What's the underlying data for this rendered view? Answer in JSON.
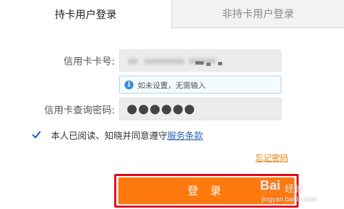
{
  "tabs": {
    "active_label": "持卡用户登录",
    "inactive_label": "非持卡用户登录"
  },
  "form": {
    "card_label": "信用卡卡号:",
    "card_value_masked": "",
    "hint_icon": "info-icon",
    "hint_text": "如未设置，无需输入",
    "password_label": "信用卡查询密码:",
    "password_mask": "●●●●●●"
  },
  "agreement": {
    "checked": true,
    "text": "本人已阅读、知晓并同意遵守",
    "link": "服务条款"
  },
  "forgot_password": "忘记密码",
  "login_button": "登 录",
  "colors": {
    "accent_orange": "#ff7a0e",
    "highlight_red": "#e4001b",
    "link_blue": "#2a62b5",
    "hint_blue": "#3a8fd9"
  },
  "watermark": {
    "logo": "Bai",
    "sub": "经验",
    "url": "jingyan.baidu.com"
  }
}
